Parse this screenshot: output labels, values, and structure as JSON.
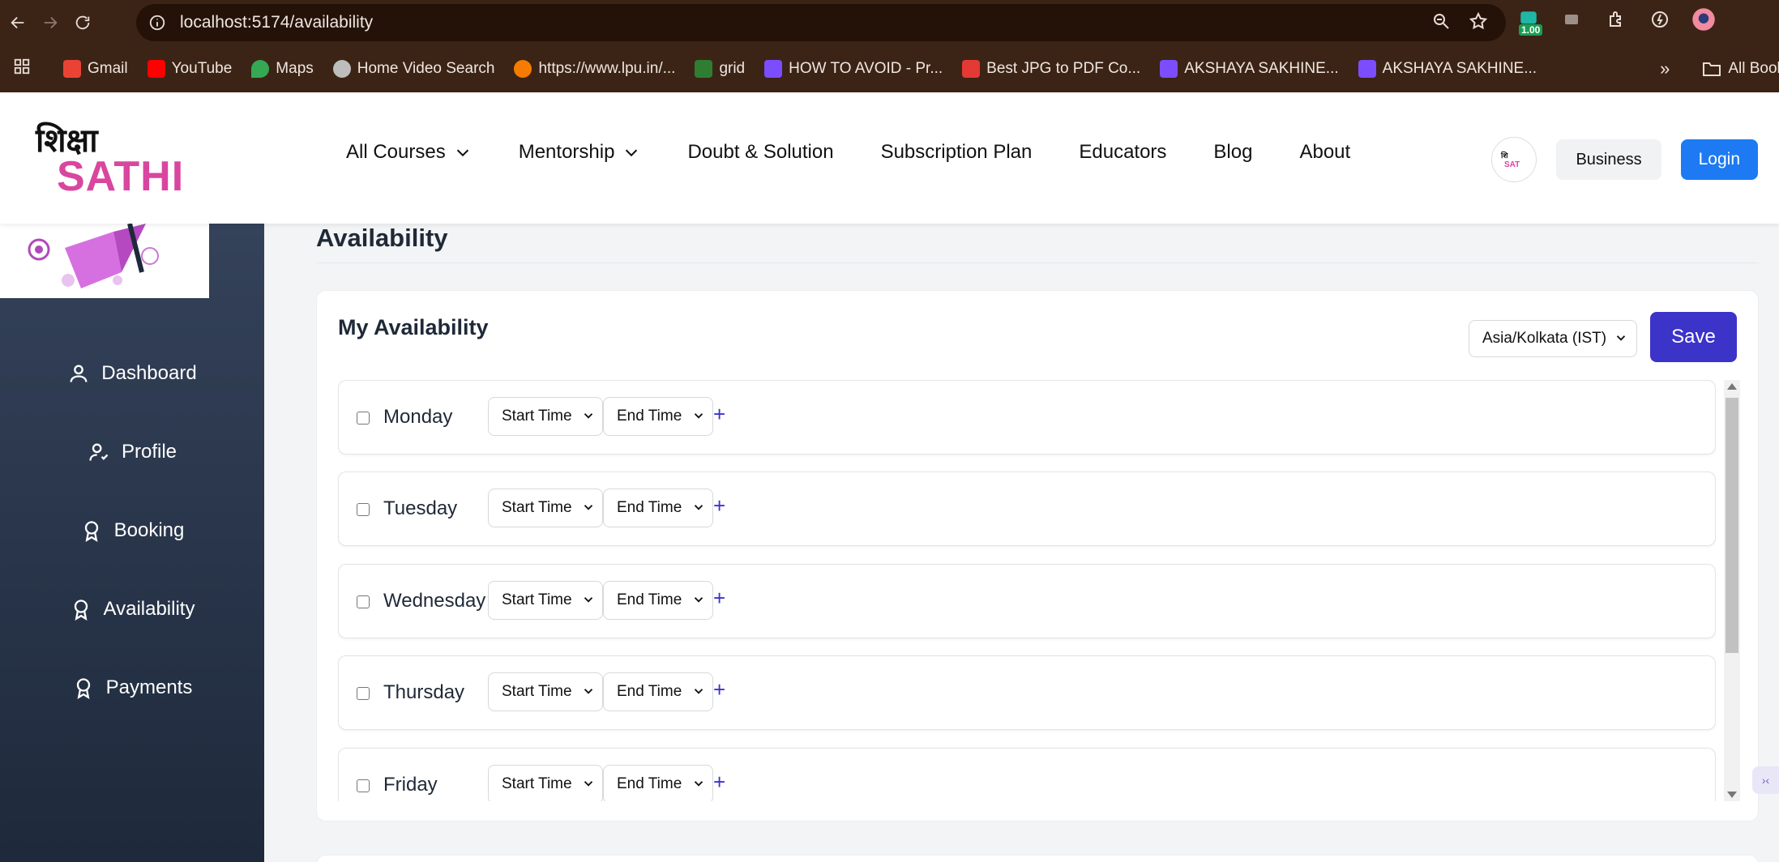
{
  "browser": {
    "url": "localhost:5174/availability",
    "extension_badge": "1.00",
    "bookmarks": [
      {
        "label": "Gmail",
        "color": "#ea4335"
      },
      {
        "label": "YouTube",
        "color": "#ff0000"
      },
      {
        "label": "Maps",
        "color": "#34a853"
      },
      {
        "label": "Home Video Search",
        "color": "#bdbdbd"
      },
      {
        "label": "https://www.lpu.in/...",
        "color": "#f57c00"
      },
      {
        "label": "grid",
        "color": "#2e7d32"
      },
      {
        "label": "HOW TO AVOID - Pr...",
        "color": "#7c4dff"
      },
      {
        "label": "Best JPG to PDF Co...",
        "color": "#e53935"
      },
      {
        "label": "AKSHAYA SAKHINE...",
        "color": "#7c4dff"
      },
      {
        "label": "AKSHAYA SAKHINE...",
        "color": "#7c4dff"
      }
    ],
    "all_bookmarks": "All Bookmark"
  },
  "header": {
    "logo_top": "शिक्षा",
    "logo_bottom": "SATHI",
    "nav": {
      "all_courses": "All Courses",
      "mentorship": "Mentorship",
      "doubt": "Doubt & Solution",
      "subscription": "Subscription Plan",
      "educators": "Educators",
      "blog": "Blog",
      "about": "About"
    },
    "business": "Business",
    "login": "Login"
  },
  "sidebar": {
    "items": [
      {
        "label": "Dashboard",
        "icon": "user-icon"
      },
      {
        "label": "Profile",
        "icon": "user-check-icon"
      },
      {
        "label": "Booking",
        "icon": "award-icon"
      },
      {
        "label": "Availability",
        "icon": "award-icon"
      },
      {
        "label": "Payments",
        "icon": "award-icon"
      }
    ]
  },
  "page": {
    "title": "Availability",
    "card_title": "My Availability",
    "timezone": "Asia/Kolkata (IST)",
    "save": "Save",
    "days": [
      {
        "name": "Monday",
        "start": "Start Time",
        "end": "End Time",
        "add": "+"
      },
      {
        "name": "Tuesday",
        "start": "Start Time",
        "end": "End Time",
        "add": "+"
      },
      {
        "name": "Wednesday",
        "start": "Start Time",
        "end": "End Time",
        "add": "+"
      },
      {
        "name": "Thursday",
        "start": "Start Time",
        "end": "End Time",
        "add": "+"
      },
      {
        "name": "Friday",
        "start": "Start Time",
        "end": "End Time",
        "add": "+"
      }
    ]
  },
  "colors": {
    "brand_pink": "#d946a0",
    "primary_blue": "#1d7af3",
    "save_indigo": "#3c33c9",
    "sidebar_dark": "#1e293b",
    "chrome_brown": "#3b2416"
  }
}
